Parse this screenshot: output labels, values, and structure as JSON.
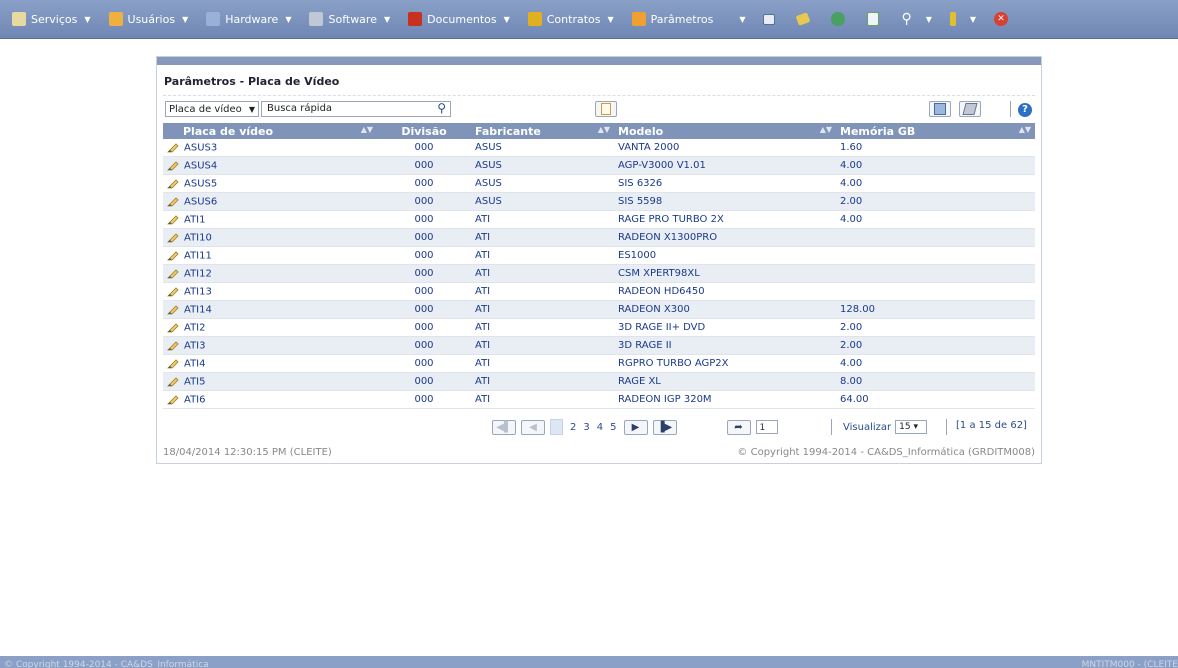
{
  "menu": [
    {
      "label": "Serviços",
      "icon": "services-icon",
      "color": "#e8d9a0"
    },
    {
      "label": "Usuários",
      "icon": "users-icon",
      "color": "#f0b040"
    },
    {
      "label": "Hardware",
      "icon": "hardware-icon",
      "color": "#9ab0d8"
    },
    {
      "label": "Software",
      "icon": "software-icon",
      "color": "#c0c8d8"
    },
    {
      "label": "Documentos",
      "icon": "documents-icon",
      "color": "#c83020"
    },
    {
      "label": "Contratos",
      "icon": "contracts-icon",
      "color": "#e0b020"
    },
    {
      "label": "Parâmetros",
      "icon": "parameters-icon",
      "color": "#f0a030"
    }
  ],
  "panel": {
    "title": "Parâmetros - Placa de Vídeo",
    "filter_select": "Placa de vídeo",
    "search_placeholder": "Busca rápida",
    "help_label": "?"
  },
  "table": {
    "headers": [
      "Placa de vídeo",
      "Divisão",
      "Fabricante",
      "Modelo",
      "Memória GB"
    ],
    "rows": [
      [
        "ASUS3",
        "000",
        "ASUS",
        "VANTA 2000",
        "1.60"
      ],
      [
        "ASUS4",
        "000",
        "ASUS",
        "AGP-V3000 V1.01",
        "4.00"
      ],
      [
        "ASUS5",
        "000",
        "ASUS",
        "SIS 6326",
        "4.00"
      ],
      [
        "ASUS6",
        "000",
        "ASUS",
        "SIS 5598",
        "2.00"
      ],
      [
        "ATI1",
        "000",
        "ATI",
        "RAGE PRO TURBO 2X",
        "4.00"
      ],
      [
        "ATI10",
        "000",
        "ATI",
        "RADEON X1300PRO",
        ""
      ],
      [
        "ATI11",
        "000",
        "ATI",
        "ES1000",
        ""
      ],
      [
        "ATI12",
        "000",
        "ATI",
        "CSM XPERT98XL",
        ""
      ],
      [
        "ATI13",
        "000",
        "ATI",
        "RADEON HD6450",
        ""
      ],
      [
        "ATI14",
        "000",
        "ATI",
        "RADEON X300",
        "128.00"
      ],
      [
        "ATI2",
        "000",
        "ATI",
        "3D RAGE II+ DVD",
        "2.00"
      ],
      [
        "ATI3",
        "000",
        "ATI",
        "3D RAGE II",
        "2.00"
      ],
      [
        "ATI4",
        "000",
        "ATI",
        "RGPRO TURBO AGP2X",
        "4.00"
      ],
      [
        "ATI5",
        "000",
        "ATI",
        "RAGE XL",
        "8.00"
      ],
      [
        "ATI6",
        "000",
        "ATI",
        "RADEON IGP 320M",
        "64.00"
      ]
    ]
  },
  "pager": {
    "pages": [
      "2",
      "3",
      "4",
      "5"
    ],
    "goto_value": "1",
    "view_label": "Visualizar",
    "view_value": "15",
    "range": "[1 a 15 de 62]"
  },
  "footer": {
    "timestamp": "18/04/2014  12:30:15 PM (CLEITE)",
    "copyright": "© Copyright 1994-2014 - CA&DS_Informática (GRDITM008)"
  },
  "bottombar": {
    "left": "© Copyright 1994-2014 - CA&DS_Informática",
    "right": "MNTITM000 - (CLEITE"
  }
}
